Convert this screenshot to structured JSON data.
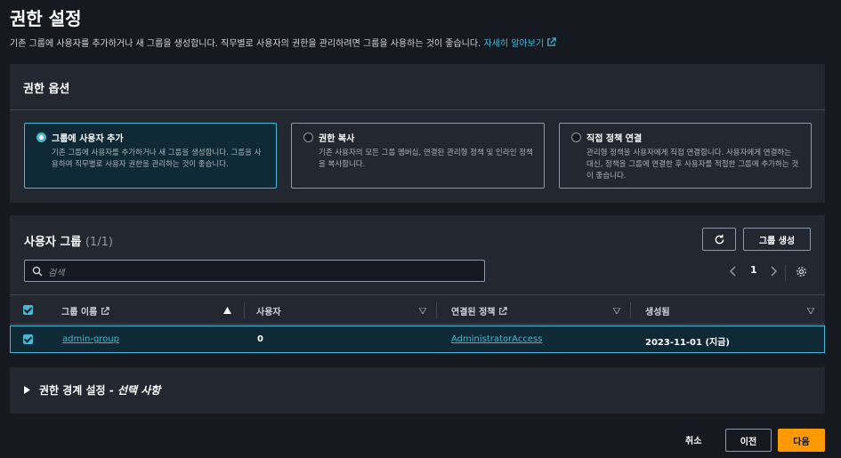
{
  "page": {
    "title": "권한 설정",
    "description": "기존 그룹에 사용자를 추가하거나 새 그룹을 생성합니다. 직무별로 사용자의 권한을 관리하려면 그룹을 사용하는 것이 좋습니다.",
    "learn_more": "자세히 알아보기"
  },
  "options_panel": {
    "title": "권한 옵션",
    "options": [
      {
        "title": "그룹에 사용자 추가",
        "desc": "기존 그룹에 사용자를 추가하거나 새 그룹을 생성합니다. 그룹을 사용하여 직무별로 사용자 권한을 관리하는 것이 좋습니다.",
        "selected": true
      },
      {
        "title": "권한 복사",
        "desc": "기존 사용자의 모든 그룹 멤버십, 연결된 관리형 정책 및 인라인 정책을 복사합니다.",
        "selected": false
      },
      {
        "title": "직접 정책 연결",
        "desc": "관리형 정책을 사용자에게 직접 연결합니다. 사용자에게 연결하는 대신, 정책을 그룹에 연결한 후 사용자를 적절한 그룹에 추가하는 것이 좋습니다.",
        "selected": false
      }
    ]
  },
  "groups_panel": {
    "title": "사용자 그룹",
    "count": "(1/1)",
    "create_button": "그룹 생성",
    "search_placeholder": "검색",
    "page_number": "1",
    "columns": {
      "name": "그룹 이름",
      "users": "사용자",
      "policies": "연결된 정책",
      "created": "생성됨"
    },
    "rows": [
      {
        "name": "admin-group",
        "users": "0",
        "policies": "AdministratorAccess",
        "created": "2023-11-01 (지금)",
        "checked": true
      }
    ]
  },
  "boundary_panel": {
    "title": "권한 경계 설정 -",
    "optional": "선택 사항"
  },
  "footer": {
    "cancel": "취소",
    "previous": "이전",
    "next": "다음"
  },
  "colors": {
    "accent": "#44b9d6",
    "primary_button": "#ff9900",
    "background": "#16191f",
    "panel": "#232730"
  }
}
